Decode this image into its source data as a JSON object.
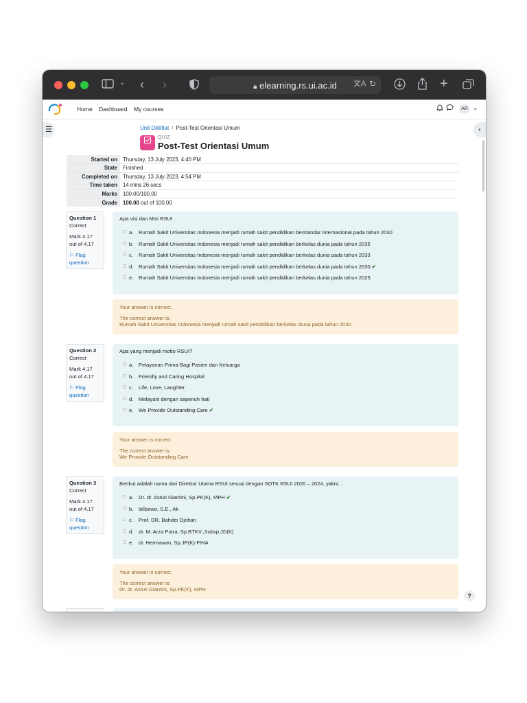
{
  "browser": {
    "url": "elearning.rs.ui.ac.id"
  },
  "nav": {
    "items": [
      "Home",
      "Dashboard",
      "My courses"
    ],
    "avatar_initials": "AR"
  },
  "breadcrumb": {
    "parent": "Unit Diklitlat",
    "separator": "/",
    "current": "Post-Test Orientasi Umum"
  },
  "header": {
    "label": "QUIZ",
    "title": "Post-Test Orientasi Umum"
  },
  "summary": [
    {
      "label": "Started on",
      "value": "Thursday, 13 July 2023, 4:40 PM"
    },
    {
      "label": "State",
      "value": "Finished"
    },
    {
      "label": "Completed on",
      "value": "Thursday, 13 July 2023, 4:54 PM"
    },
    {
      "label": "Time taken",
      "value": "14 mins 26 secs"
    },
    {
      "label": "Marks",
      "value": "100.00/100.00"
    },
    {
      "label": "Grade",
      "value_bold": "100.00",
      "value_rest": " out of 100.00"
    }
  ],
  "questions": [
    {
      "number": "Question 1",
      "state": "Correct",
      "mark": "Mark 4.17",
      "out_of": "out of 4.17",
      "flag": "Flag question",
      "text": "Apa visi dan Misi RSUI",
      "options": [
        {
          "letter": "a.",
          "text": "Rumah Sakit Universitas Indonesia menjadi rumah sakit pendidikan berstandar internasional pada tahun 2030"
        },
        {
          "letter": "b.",
          "text": "Rumah Sakit Universitas Indonesia menjadi rumah sakit pendidikan berkelas dunia pada tahun 2035"
        },
        {
          "letter": "c.",
          "text": "Rumah Sakit Universitas Indonesia menjadi rumah sakit pendidikan berkelas dunia pada tahun 2033"
        },
        {
          "letter": "d.",
          "text": "Rumah Sakit Universitas Indonesia menjadi rumah sakit pendidikan berkelas dunia pada tahun 2030"
        },
        {
          "letter": "e.",
          "text": "Rumah Sakit Universitas Indonesia menjadi rumah sakit pendidikan berkelas dunia pada tahun 2025"
        }
      ],
      "feedback_correct": "Your answer is correct.",
      "feedback_label": "The correct answer is:",
      "feedback_answer": "Rumah Sakit Universitas Indonesia menjadi rumah sakit pendidikan berkelas dunia pada tahun 2030"
    },
    {
      "number": "Question 2",
      "state": "Correct",
      "mark": "Mark 4.17",
      "out_of": "out of 4.17",
      "flag": "Flag question",
      "text": "Apa yang menjadi motto RSUI?",
      "options": [
        {
          "letter": "a.",
          "text": "Pelayanan Prima Bagi Pasien dan Keluarga"
        },
        {
          "letter": "b.",
          "text": "Friendly and Caring Hospital"
        },
        {
          "letter": "c.",
          "text": "Life, Love, Laughter"
        },
        {
          "letter": "d.",
          "text": "Melayani dengan sepenuh hati"
        },
        {
          "letter": "e.",
          "text": "We Provide Outstanding Care"
        }
      ],
      "feedback_correct": "Your answer is correct.",
      "feedback_label": "The correct answer is:",
      "feedback_answer": "We Provide Outstanding Care"
    },
    {
      "number": "Question 3",
      "state": "Correct",
      "mark": "Mark 4.17",
      "out_of": "out of 4.17",
      "flag": "Flag question",
      "text": "Berikut adalah nama dari Direktur Utama RSUI sesuai dengan SOTK RSUI 2020 – 2024, yakni...",
      "options": [
        {
          "letter": "a.",
          "text": "Dr. dr. Astuti Giantini, Sp.PK(K), MPH"
        },
        {
          "letter": "b.",
          "text": "Wibowo, S.E., Ak"
        },
        {
          "letter": "c.",
          "text": "Prof. DR. Bahder Djohan"
        },
        {
          "letter": "d.",
          "text": "dr. M. Arza Putra, Sp.BTKV.,Subsp.JD(K)"
        },
        {
          "letter": "e.",
          "text": "dr. Hermawan, Sp.JP(K)-FIHA"
        }
      ],
      "feedback_correct": "Your answer is correct.",
      "feedback_label": "The correct answer is:",
      "feedback_answer": "Dr. dr. Astuti Giantini, Sp.PK(K), MPH"
    }
  ],
  "help_label": "?"
}
